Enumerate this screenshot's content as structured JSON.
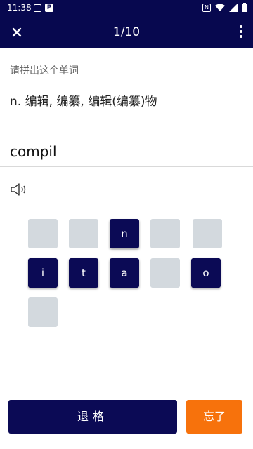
{
  "status_bar": {
    "time": "11:38"
  },
  "header": {
    "progress": "1/10",
    "close_icon": "close-icon",
    "menu_icon": "more-vert-icon"
  },
  "prompt": "请拼出这个单词",
  "definition": "n. 编辑, 编纂, 编辑(编纂)物",
  "typed_word": "compil",
  "tiles": [
    {
      "label": ""
    },
    {
      "label": ""
    },
    {
      "label": "n"
    },
    {
      "label": ""
    },
    {
      "label": ""
    },
    {
      "label": "i"
    },
    {
      "label": "t"
    },
    {
      "label": "a"
    },
    {
      "label": ""
    },
    {
      "label": "o"
    },
    {
      "label": ""
    }
  ],
  "buttons": {
    "backspace": "退格",
    "forgot": "忘了"
  },
  "colors": {
    "primary": "#07084f",
    "accent": "#f7720c",
    "empty_tile": "#d3d9de"
  }
}
